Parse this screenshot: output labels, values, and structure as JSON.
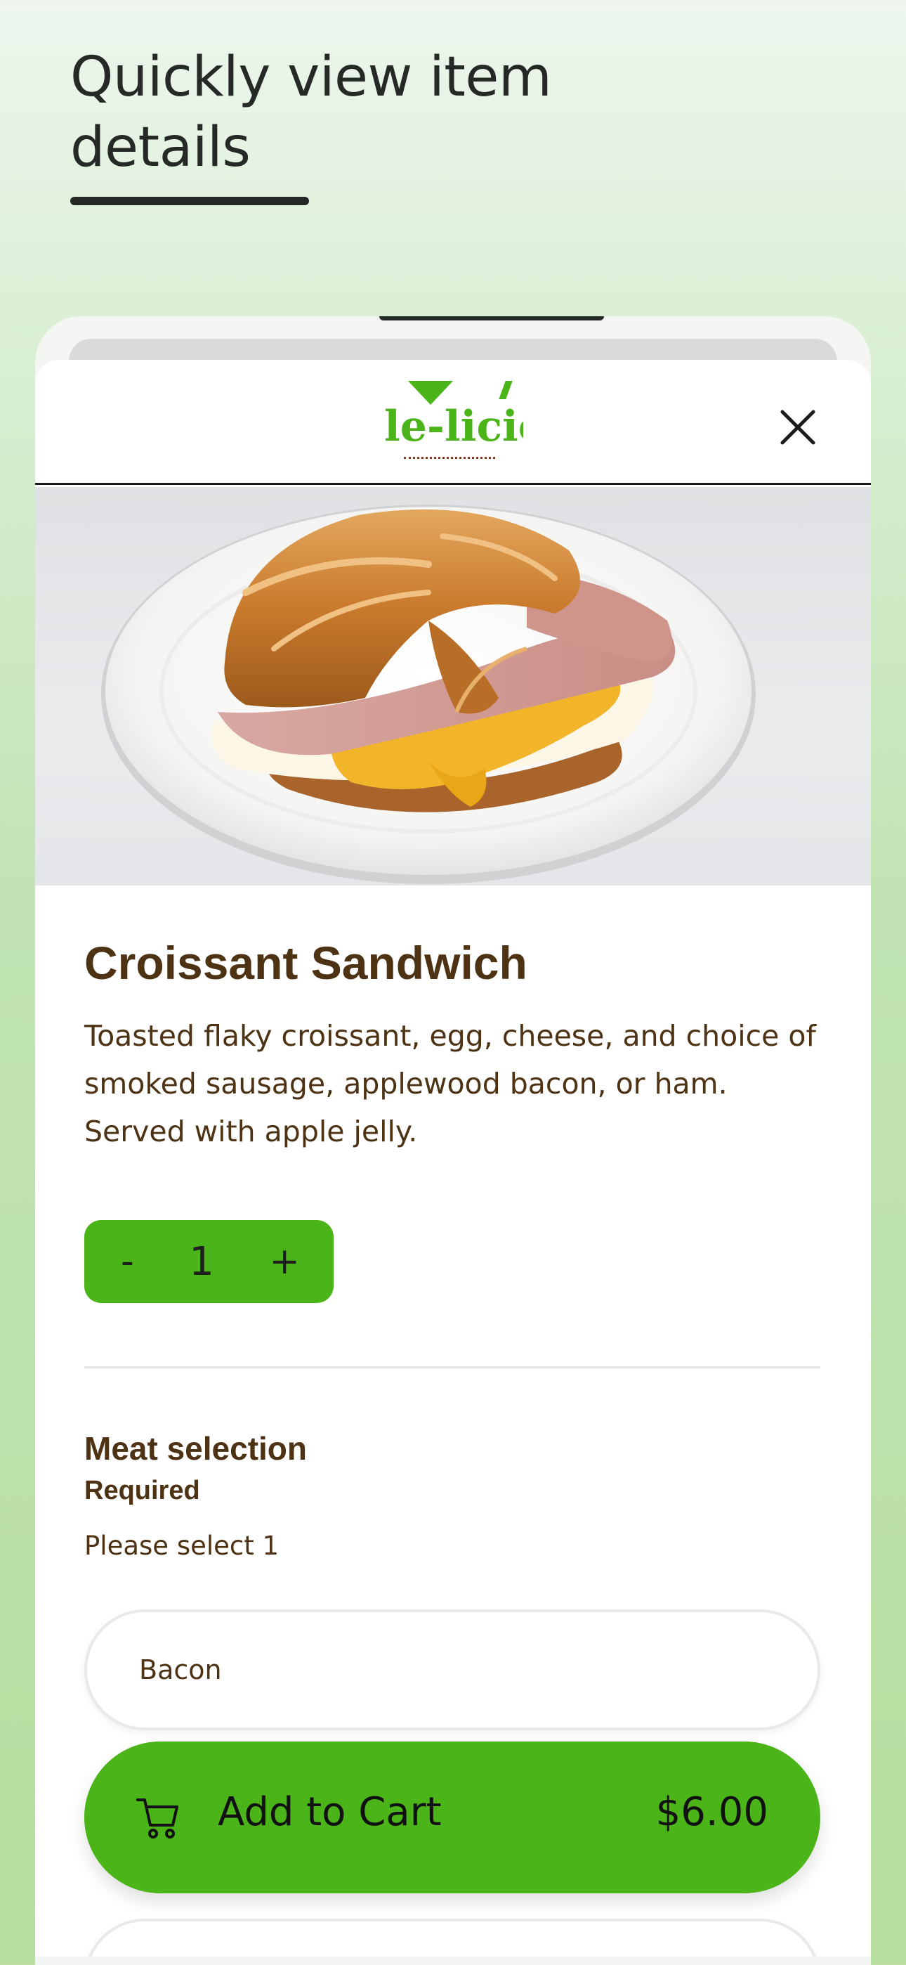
{
  "headline": {
    "text": "Quickly view item details"
  },
  "header": {
    "logo_text": "le-licio"
  },
  "item": {
    "title": "Croissant Sandwich",
    "description": "Toasted flaky croissant, egg, cheese, and choice of smoked sausage, applewood bacon, or ham. Served with apple jelly."
  },
  "quantity": {
    "minus_label": "-",
    "value": "1",
    "plus_label": "+"
  },
  "meat_selection": {
    "title": "Meat selection",
    "required_label": "Required",
    "hint": "Please select 1",
    "options": [
      {
        "label": "Bacon"
      },
      {
        "label": ""
      }
    ]
  },
  "cart_button": {
    "label": "Add to Cart",
    "price": "$6.00"
  },
  "colors": {
    "accent_green": "#4bb418",
    "text_brown": "#4d3214",
    "headline_dark": "#262a27"
  },
  "icons": {
    "close": "close-icon",
    "cart": "cart-icon",
    "logo": "logo-icon"
  }
}
